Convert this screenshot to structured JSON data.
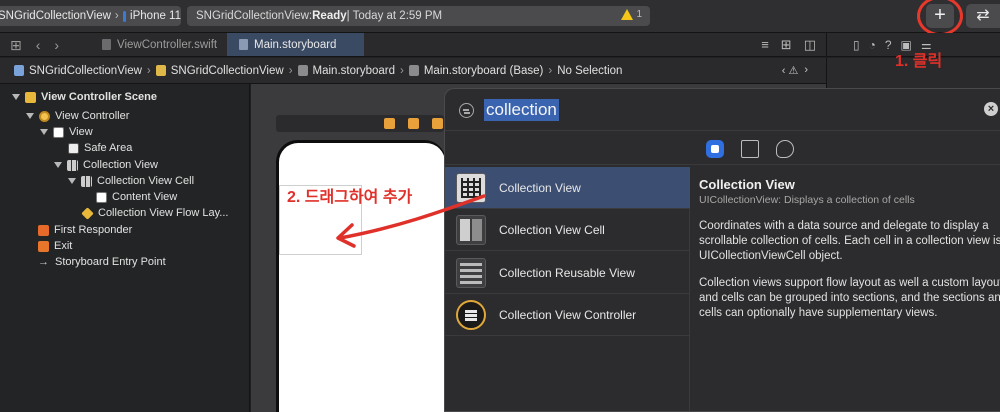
{
  "toolbar": {
    "scheme": "SNGridCollectionView",
    "device": "iPhone 11",
    "activity_name": "SNGridCollectionView: ",
    "activity_status": "Ready",
    "activity_time": " | Today at 2:59 PM",
    "warning_count": "1",
    "plus_label": "+",
    "swap_label": "⇄"
  },
  "tabs": [
    {
      "label": "ViewController.swift"
    },
    {
      "label": "Main.storyboard"
    }
  ],
  "jumpbar": [
    "SNGridCollectionView",
    "SNGridCollectionView",
    "Main.storyboard",
    "Main.storyboard (Base)",
    "No Selection"
  ],
  "outline": [
    {
      "label": "View Controller Scene"
    },
    {
      "label": "View Controller"
    },
    {
      "label": "View"
    },
    {
      "label": "Safe Area"
    },
    {
      "label": "Collection View"
    },
    {
      "label": "Collection View Cell"
    },
    {
      "label": "Content View"
    },
    {
      "label": "Collection View Flow Lay..."
    },
    {
      "label": "First Responder"
    },
    {
      "label": "Exit"
    },
    {
      "label": "Storyboard Entry Point"
    }
  ],
  "library": {
    "query": "collection",
    "items": [
      {
        "label": "Collection View"
      },
      {
        "label": "Collection View Cell"
      },
      {
        "label": "Collection Reusable View"
      },
      {
        "label": "Collection View Controller"
      }
    ],
    "detail": {
      "title": "Collection View",
      "subtitle": "UICollectionView: Displays a collection of cells",
      "para1": "Coordinates with a data source and delegate to display a scrollable collection of cells. Each cell in a collection view is a UICollectionViewCell object.",
      "para2": "Collection views support flow layout as well a custom layouts, and cells can be grouped into sections, and the sections and cells can optionally have supplementary views."
    }
  },
  "annotations": {
    "click": "1. 클릭",
    "drag": "2. 드래그하여 추가"
  },
  "colors": {
    "accent": "#2f6fe0",
    "selection": "#3c4f73",
    "annotation_red": "#e0302a"
  }
}
